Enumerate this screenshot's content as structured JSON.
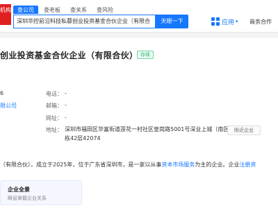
{
  "header": {
    "logo_text": "机构",
    "tabs": [
      "查公司",
      "查老板",
      "查关系",
      "查风险"
    ],
    "search_value": "深圳华控前沿科技私募创业投资基金合伙企业（有限合",
    "search_button": "天眼一下",
    "apps_label": "应用",
    "business_label": "商务合作"
  },
  "company": {
    "name": "创业投资基金合伙企业（有限合伙）",
    "status": "存续",
    "left_fragment_1": "6",
    "left_fragment_2": "限公司",
    "phone_label": "电话：",
    "phone_value": "-",
    "email_label": "邮箱：",
    "email_value": "-",
    "website_label": "网址：",
    "website_value": "-",
    "address_label": "地址：",
    "address_value": "深圳市福田区华富街道莲花一村社区皇岗路5001号深业上城（南区）T2栋42层42074",
    "nearby_button": "附近企业"
  },
  "description": {
    "text_before": "（有限合伙），成立于2025年，位于广东省深圳市，是一家以从事",
    "link_1": "资本市场服务",
    "text_middle": "为主的企业。企业",
    "link_2": "注册资"
  },
  "panorama": {
    "title": "企业全景",
    "subtitle": "瞬息掌握企业关系"
  },
  "colors": {
    "accent": "#1677ff",
    "status_green": "#2bb673",
    "logo_red": "#e02020"
  }
}
